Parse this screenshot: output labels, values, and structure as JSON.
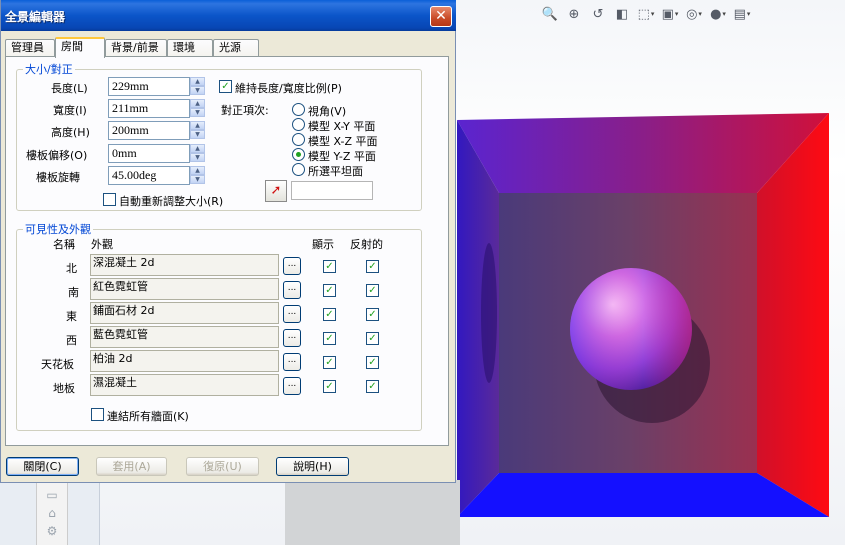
{
  "dialog": {
    "title": "全景編輯器",
    "close_glyph": "✕"
  },
  "tabs": [
    {
      "label": "管理員",
      "active": false
    },
    {
      "label": "房間",
      "active": true
    },
    {
      "label": "背景/前景",
      "active": false
    },
    {
      "label": "環境",
      "active": false
    },
    {
      "label": "光源",
      "active": false
    }
  ],
  "size_align": {
    "legend": "大小/對正",
    "fields": [
      {
        "label": "長度(L)",
        "value": "229mm"
      },
      {
        "label": "寬度(I)",
        "value": "211mm"
      },
      {
        "label": "高度(H)",
        "value": "200mm"
      },
      {
        "label": "樓板偏移(O)",
        "value": "0mm"
      },
      {
        "label": "樓板旋轉",
        "value": "45.00deg"
      }
    ],
    "keep_ratio_label": "維持長度/寬度比例(P)",
    "keep_ratio_checked": true,
    "align_label": "對正項次:",
    "align_options": [
      {
        "label": "視角(V)",
        "selected": false
      },
      {
        "label": "模型 X-Y 平面",
        "selected": false
      },
      {
        "label": "模型 X-Z 平面",
        "selected": false
      },
      {
        "label": "模型 Y-Z 平面",
        "selected": true
      },
      {
        "label": "所選平坦面",
        "selected": false
      }
    ],
    "selected_face_value": "",
    "auto_resize_label": "自動重新調整大小(R)",
    "auto_resize_checked": false
  },
  "visibility": {
    "legend": "可見性及外觀",
    "col_name": "名稱",
    "col_appearance": "外觀",
    "col_show": "顯示",
    "col_reflect": "反射的",
    "browse_glyph": "...",
    "rows": [
      {
        "name": "北",
        "appearance": "深混凝土 2d",
        "show": true,
        "reflect": true
      },
      {
        "name": "南",
        "appearance": "紅色霓虹管",
        "show": true,
        "reflect": true
      },
      {
        "name": "東",
        "appearance": "鋪面石材 2d",
        "show": true,
        "reflect": true
      },
      {
        "name": "西",
        "appearance": "藍色霓虹管",
        "show": true,
        "reflect": true
      },
      {
        "name": "天花板",
        "appearance": "柏油 2d",
        "show": true,
        "reflect": true
      },
      {
        "name": "地板",
        "appearance": "濕混凝土",
        "show": true,
        "reflect": true
      }
    ],
    "link_walls_label": "連結所有牆面(K)",
    "link_walls_checked": false
  },
  "buttons": {
    "close": "關閉(C)",
    "apply": "套用(A)",
    "reset": "復原(U)",
    "help": "說明(H)"
  },
  "toolbar_icons": [
    "zoom-fit-icon",
    "zoom-area-icon",
    "previous-view-icon",
    "section-view-icon",
    "view-orientation-icon",
    "display-style-icon",
    "hide-show-icon",
    "edit-appearance-icon",
    "scene-icon"
  ],
  "colors": {
    "title_bar": "#0b55c9",
    "group_legend": "#0046d5",
    "room_red": "#ff0a1a",
    "room_blue": "#1a0aff"
  }
}
